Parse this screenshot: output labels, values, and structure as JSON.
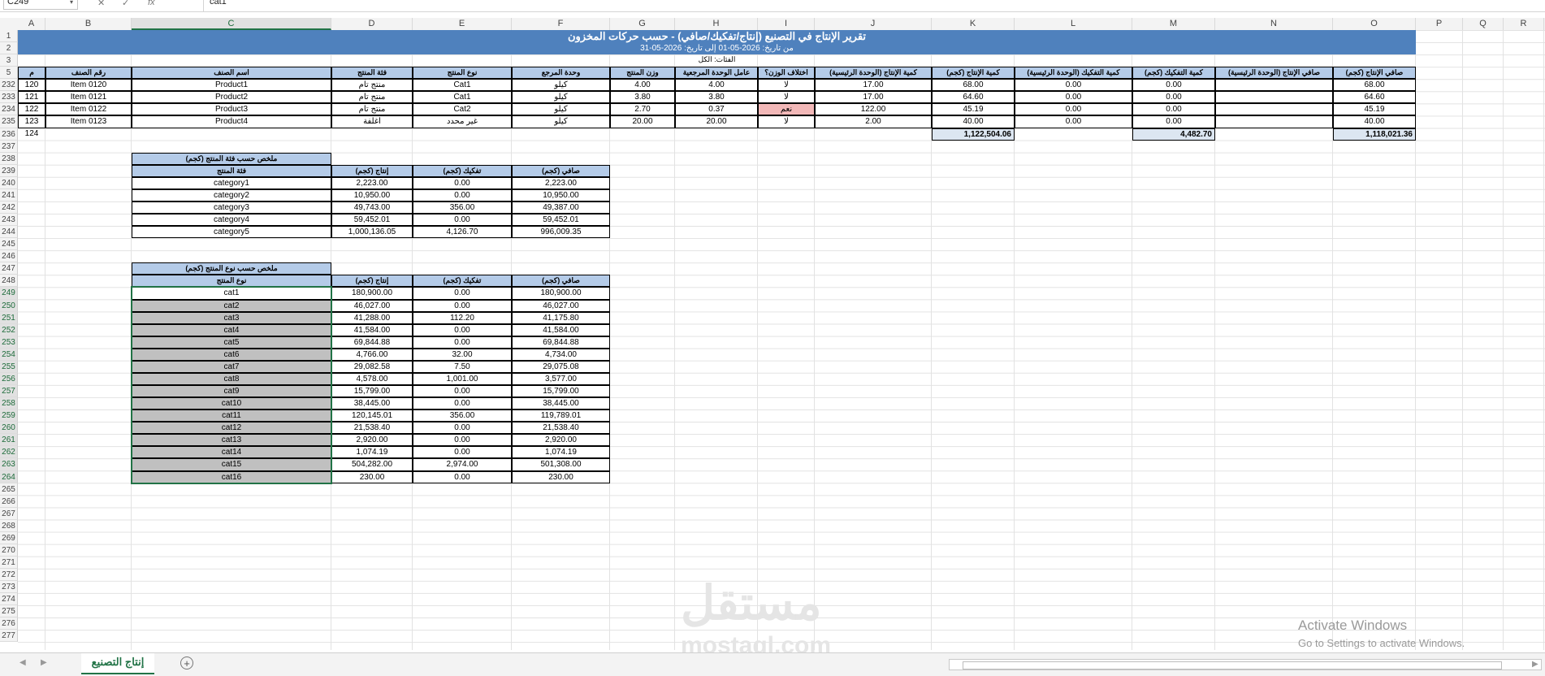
{
  "formula_bar": {
    "name_box": "C249",
    "formula": "cat1",
    "cancel_icon": "✕",
    "enter_icon": "✓",
    "fx_label": "fx"
  },
  "columns": [
    "A",
    "B",
    "C",
    "D",
    "E",
    "F",
    "G",
    "H",
    "I",
    "J",
    "K",
    "L",
    "M",
    "N",
    "O",
    "P",
    "Q",
    "R"
  ],
  "report": {
    "title": "تقرير الإنتاج في التصنيع (إنتاج/تفكيك/صافي) - حسب حركات المخزون",
    "date_line": "من تاريخ: 2026-05-01    إلى تاريخ: 2026-05-31",
    "categories_line": "الفئات: الكل"
  },
  "main_table": {
    "headers": [
      "م",
      "رقم الصنف",
      "اسم الصنف",
      "فئة المنتج",
      "نوع المنتج",
      "وحدة المرجع",
      "وزن المنتج",
      "عامل الوحدة المرجعية",
      "اختلاف الوزن؟",
      "كمية الإنتاج (الوحدة الرئيسية)",
      "كمية الإنتاج (كجم)",
      "كمية التفكيك (الوحدة الرئيسية)",
      "كمية التفكيك (كجم)",
      "صافي الإنتاج (الوحدة الرئيسية)",
      "صافي الإنتاج (كجم)"
    ],
    "row_numbers": [
      "232",
      "233",
      "234",
      "235",
      "236"
    ],
    "rows": [
      [
        "120",
        "Item 0120",
        "Product1",
        "منتج تام",
        "Cat1",
        "كيلو",
        "4.00",
        "4.00",
        "لا",
        "17.00",
        "68.00",
        "0.00",
        "0.00",
        "",
        "68.00"
      ],
      [
        "121",
        "Item 0121",
        "Product2",
        "منتج تام",
        "Cat1",
        "كيلو",
        "3.80",
        "3.80",
        "لا",
        "17.00",
        "64.60",
        "0.00",
        "0.00",
        "",
        "64.60"
      ],
      [
        "122",
        "Item 0122",
        "Product3",
        "منتج تام",
        "Cat2",
        "كيلو",
        "2.70",
        "0.37",
        "نعم",
        "122.00",
        "45.19",
        "0.00",
        "0.00",
        "",
        "45.19"
      ],
      [
        "123",
        "Item 0123",
        "Product4",
        "اغلفة",
        "غير محدد",
        "كيلو",
        "20.00",
        "20.00",
        "لا",
        "2.00",
        "40.00",
        "0.00",
        "0.00",
        "",
        "40.00"
      ]
    ],
    "totals_count": "124",
    "total_production_kg": "1,122,504.06",
    "total_disassembly_kg": "4,482.70",
    "total_net_kg": "1,118,021.36"
  },
  "category_summary": {
    "title": "ملخص حسب فئة المنتج (كجم)",
    "headers": [
      "فئة المنتج",
      "إنتاج (كجم)",
      "تفكيك (كجم)",
      "صافي (كجم)"
    ],
    "rows": [
      [
        "category1",
        "2,223.00",
        "0.00",
        "2,223.00"
      ],
      [
        "category2",
        "10,950.00",
        "0.00",
        "10,950.00"
      ],
      [
        "category3",
        "49,743.00",
        "356.00",
        "49,387.00"
      ],
      [
        "category4",
        "59,452.01",
        "0.00",
        "59,452.01"
      ],
      [
        "category5",
        "1,000,136.05",
        "4,126.70",
        "996,009.35"
      ]
    ]
  },
  "type_summary": {
    "title": "ملخص حسب نوع المنتج (كجم)",
    "headers": [
      "نوع المنتج",
      "إنتاج (كجم)",
      "تفكيك (كجم)",
      "صافي (كجم)"
    ],
    "rows": [
      [
        "cat1",
        "180,900.00",
        "0.00",
        "180,900.00"
      ],
      [
        "cat2",
        "46,027.00",
        "0.00",
        "46,027.00"
      ],
      [
        "cat3",
        "41,288.00",
        "112.20",
        "41,175.80"
      ],
      [
        "cat4",
        "41,584.00",
        "0.00",
        "41,584.00"
      ],
      [
        "cat5",
        "69,844.88",
        "0.00",
        "69,844.88"
      ],
      [
        "cat6",
        "4,766.00",
        "32.00",
        "4,734.00"
      ],
      [
        "cat7",
        "29,082.58",
        "7.50",
        "29,075.08"
      ],
      [
        "cat8",
        "4,578.00",
        "1,001.00",
        "3,577.00"
      ],
      [
        "cat9",
        "15,799.00",
        "0.00",
        "15,799.00"
      ],
      [
        "cat10",
        "38,445.00",
        "0.00",
        "38,445.00"
      ],
      [
        "cat11",
        "120,145.01",
        "356.00",
        "119,789.01"
      ],
      [
        "cat12",
        "21,538.40",
        "0.00",
        "21,538.40"
      ],
      [
        "cat13",
        "2,920.00",
        "0.00",
        "2,920.00"
      ],
      [
        "cat14",
        "1,074.19",
        "0.00",
        "1,074.19"
      ],
      [
        "cat15",
        "504,282.00",
        "2,974.00",
        "501,308.00"
      ],
      [
        "cat16",
        "230.00",
        "0.00",
        "230.00"
      ]
    ]
  },
  "row_headers": [
    "1",
    "2",
    "3",
    "5",
    "232",
    "233",
    "234",
    "235",
    "236",
    "237",
    "238",
    "239",
    "240",
    "241",
    "242",
    "243",
    "244",
    "245",
    "246",
    "247",
    "248",
    "249",
    "250",
    "251",
    "252",
    "253",
    "254",
    "255",
    "256",
    "257",
    "258",
    "259",
    "260",
    "261",
    "262",
    "263",
    "264",
    "265",
    "266",
    "267",
    "268",
    "269",
    "270",
    "271",
    "272",
    "273",
    "274",
    "275",
    "276",
    "277"
  ],
  "sheet_tab": "إنتاج التصنيع",
  "add_sheet": "+",
  "watermark": {
    "line1": "Activate Windows",
    "line2": "Go to Settings to activate Windows."
  },
  "logo": {
    "arabic": "مستقل",
    "latin": "mostaql.com"
  }
}
